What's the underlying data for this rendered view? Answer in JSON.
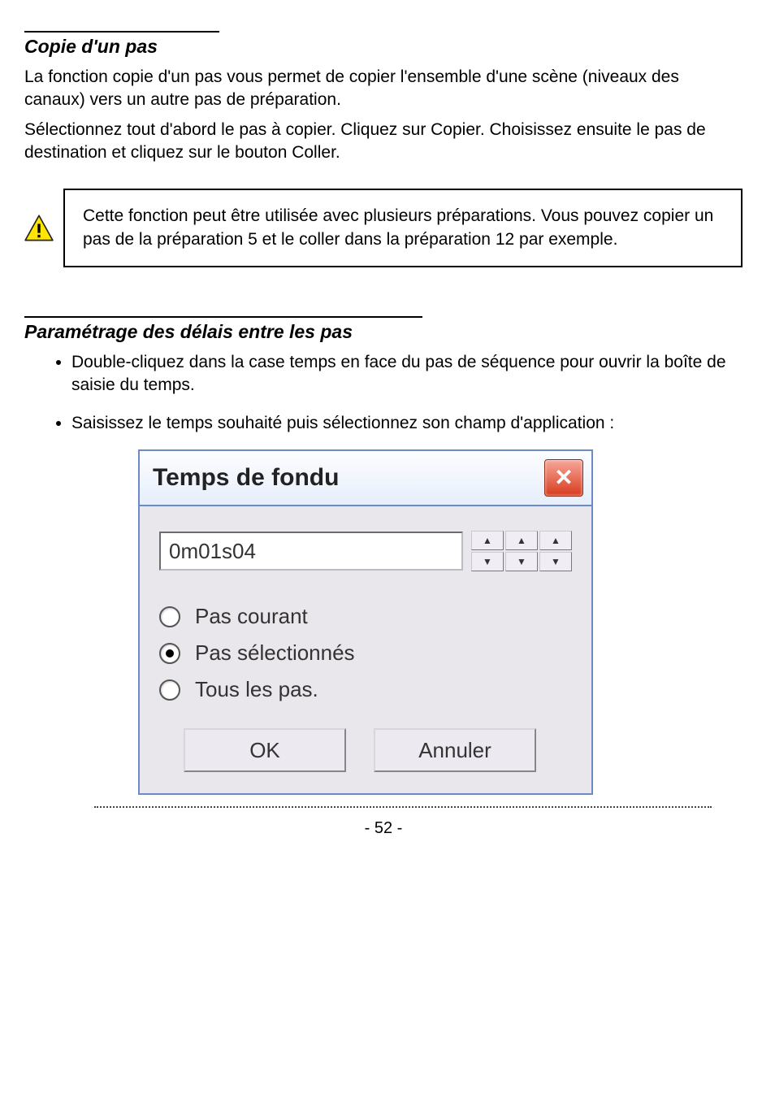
{
  "section1": {
    "title": "Copie d'un pas",
    "paragraphs": [
      "La fonction copie d'un pas vous permet de copier l'ensemble d'une scène (niveaux des canaux) vers un autre pas de préparation.",
      "Sélectionnez tout d'abord le pas à copier. Cliquez sur Copier. Choisissez ensuite le pas de destination et cliquez sur le bouton Coller."
    ]
  },
  "warning_text": "Cette fonction peut être utilisée avec plusieurs préparations. Vous pouvez copier un pas de la préparation 5 et le coller dans la préparation 12 par exemple.",
  "section2": {
    "title": "Paramétrage des délais entre les pas",
    "bullets": [
      "Double-cliquez dans la case temps en face du pas de séquence pour ouvrir la boîte de saisie du temps.",
      "Saisissez le temps souhaité puis sélectionnez son champ d'application :"
    ]
  },
  "dialog": {
    "title": "Temps de fondu",
    "input_value": "0m01s04",
    "radios": {
      "current": "Pas courant",
      "selected": "Pas sélectionnés",
      "all": "Tous les pas.",
      "checked": "selected"
    },
    "ok_label": "OK",
    "cancel_label": "Annuler"
  },
  "page_number": "- 52 -"
}
